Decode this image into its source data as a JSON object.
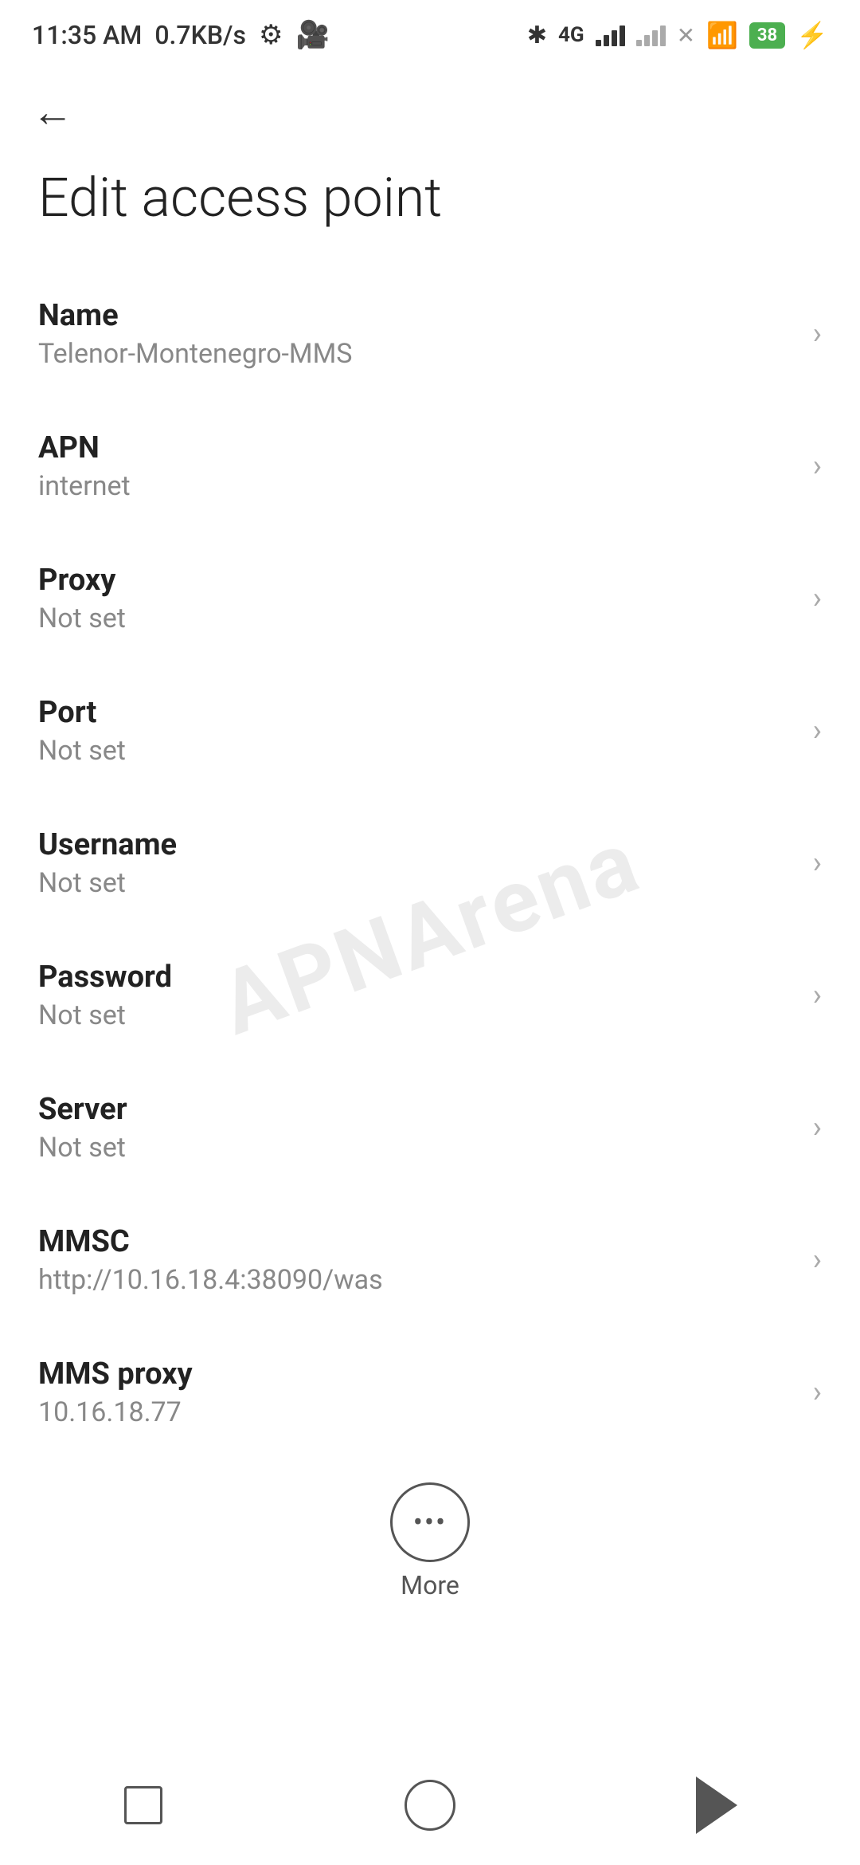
{
  "status_bar": {
    "time": "11:35 AM",
    "speed": "0.7KB/s",
    "battery": "38",
    "battery_charging": true
  },
  "page": {
    "title": "Edit access point"
  },
  "settings": [
    {
      "label": "Name",
      "value": "Telenor-Montenegro-MMS"
    },
    {
      "label": "APN",
      "value": "internet"
    },
    {
      "label": "Proxy",
      "value": "Not set"
    },
    {
      "label": "Port",
      "value": "Not set"
    },
    {
      "label": "Username",
      "value": "Not set"
    },
    {
      "label": "Password",
      "value": "Not set"
    },
    {
      "label": "Server",
      "value": "Not set"
    },
    {
      "label": "MMSC",
      "value": "http://10.16.18.4:38090/was"
    },
    {
      "label": "MMS proxy",
      "value": "10.16.18.77"
    }
  ],
  "more_button": {
    "label": "More"
  },
  "watermark": "APNArena"
}
